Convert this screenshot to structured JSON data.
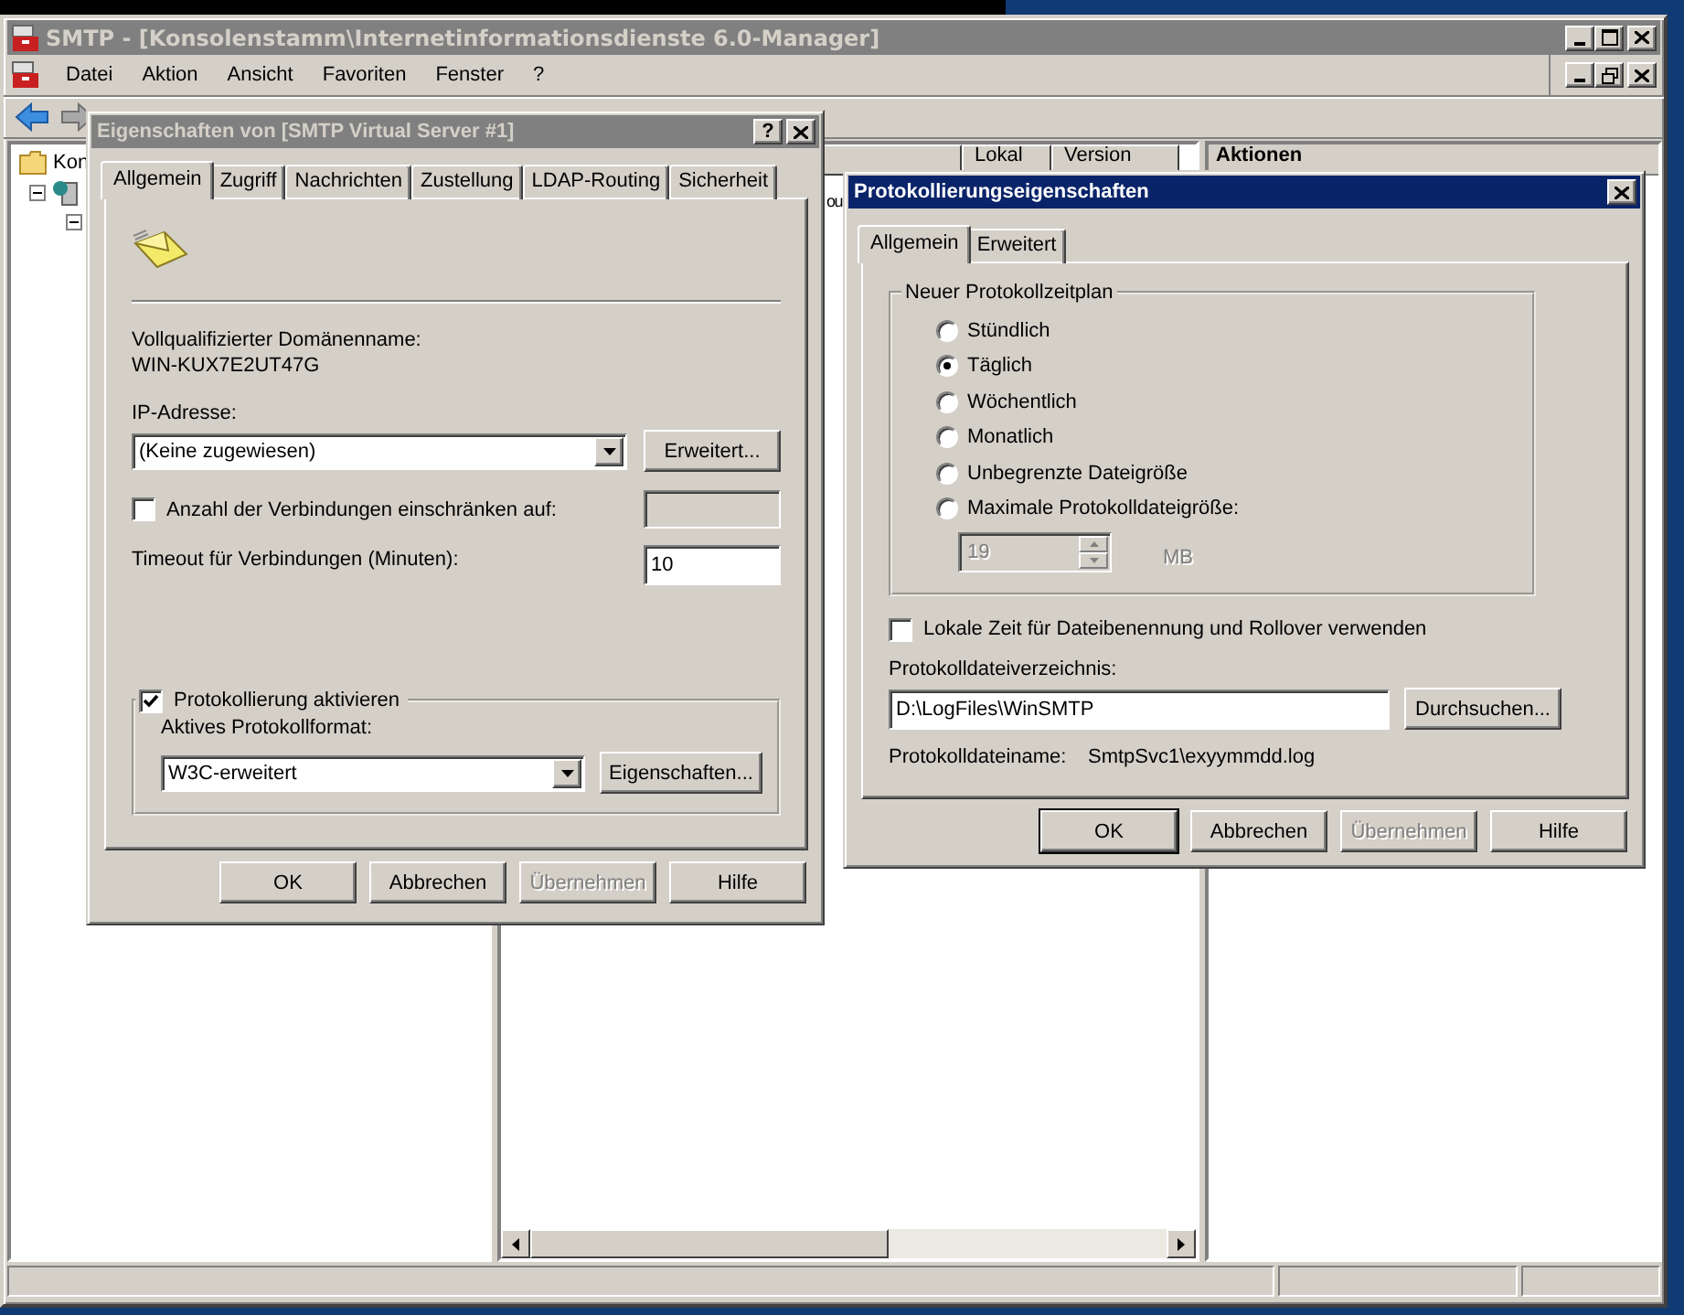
{
  "main_window": {
    "title": "SMTP - [Konsolenstamm\\Internetinformationsdienste 6.0-Manager]",
    "menu": [
      "Datei",
      "Aktion",
      "Ansicht",
      "Favoriten",
      "Fenster",
      "?"
    ]
  },
  "tree": {
    "items": [
      {
        "label": "Kon"
      }
    ]
  },
  "list": {
    "columns": [
      "Lokal",
      "Version"
    ],
    "rows": [
      "ou"
    ]
  },
  "actions_pane": {
    "title": "Aktionen"
  },
  "server_dialog": {
    "title": "Eigenschaften von [SMTP Virtual Server #1]",
    "help_button": "?",
    "tabs": [
      {
        "label": "Allgemein",
        "selected": true
      },
      {
        "label": "Zugriff",
        "selected": false
      },
      {
        "label": "Nachrichten",
        "selected": false
      },
      {
        "label": "Zustellung",
        "selected": false
      },
      {
        "label": "LDAP-Routing",
        "selected": false
      },
      {
        "label": "Sicherheit",
        "selected": false
      }
    ],
    "domain_label": "Vollqualifizierter Domänenname:",
    "domain": "WIN-KUX7E2UT47G",
    "ip_label": "IP-Adresse:",
    "ip_value": "(Keine zugewiesen)",
    "ip_button": "Erweitert...",
    "limit": {
      "label": "Anzahl der Verbindungen einschränken auf:",
      "checked": false
    },
    "timeout": {
      "label": "Timeout für Verbindungen (Minuten):",
      "value": "10"
    },
    "logging": {
      "label": "Protokollierung aktivieren",
      "checked": true,
      "format_label": "Aktives Protokollformat:",
      "format": "W3C-erweitert",
      "button": "Eigenschaften..."
    },
    "buttons": [
      {
        "label": "OK",
        "default": false,
        "disabled": false
      },
      {
        "label": "Abbrechen",
        "default": false,
        "disabled": false
      },
      {
        "label": "Übernehmen",
        "default": false,
        "disabled": true
      },
      {
        "label": "Hilfe",
        "default": false,
        "disabled": false
      }
    ]
  },
  "logging_dialog": {
    "title": "Protokollierungseigenschaften",
    "tabs": [
      {
        "label": "Allgemein",
        "selected": true
      },
      {
        "label": "Erweitert",
        "selected": false
      }
    ],
    "schedule": {
      "legend": "Neuer Protokollzeitplan",
      "options": [
        {
          "label": "Stündlich",
          "selected": false
        },
        {
          "label": "Täglich",
          "selected": true
        },
        {
          "label": "Wöchentlich",
          "selected": false
        },
        {
          "label": "Monatlich",
          "selected": false
        },
        {
          "label": "Unbegrenzte Dateigröße",
          "selected": false
        },
        {
          "label": "Maximale Protokolldateigröße:",
          "selected": false
        }
      ],
      "size": {
        "value": "19",
        "unit": "MB",
        "disabled": true
      }
    },
    "local_time": {
      "label": "Lokale Zeit für Dateibenennung und Rollover verwenden",
      "checked": false
    },
    "dir_label": "Protokolldateiverzeichnis:",
    "dir": "D:\\LogFiles\\WinSMTP",
    "browse": "Durchsuchen...",
    "filename_label": "Protokolldateiname:",
    "filename": "SmtpSvc1\\exyymmdd.log",
    "buttons": [
      {
        "label": "OK",
        "default": true,
        "disabled": false
      },
      {
        "label": "Abbrechen",
        "default": false,
        "disabled": false
      },
      {
        "label": "Übernehmen",
        "default": false,
        "disabled": true
      },
      {
        "label": "Hilfe",
        "default": false,
        "disabled": false
      }
    ]
  }
}
